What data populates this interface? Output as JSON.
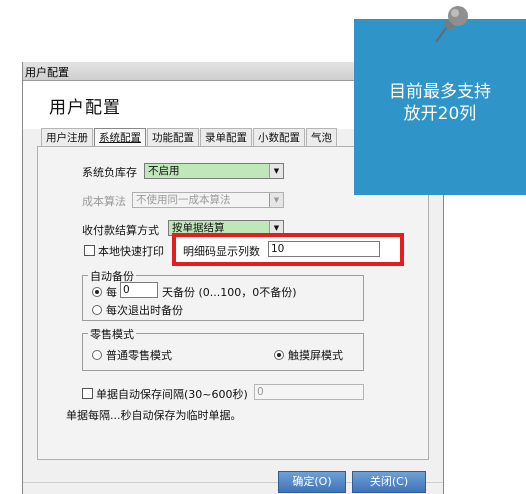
{
  "window": {
    "titlebar": "用户配置",
    "title": "用户配置",
    "tabs": [
      "用户注册",
      "系统配置",
      "功能配置",
      "录单配置",
      "小数配置",
      "气泡"
    ]
  },
  "form": {
    "inventory_label": "系统负库存",
    "inventory_value": "不启用",
    "cost_label": "成本算法",
    "cost_value": "不使用同一成本算法",
    "payment_label": "收付款结算方式",
    "payment_value": "按单据结算",
    "quick_print_label": "本地快速打印",
    "detail_columns_label": "明细码显示列数",
    "detail_columns_value": "10",
    "auto_backup": {
      "title": "自动备份",
      "every_prefix": "每",
      "every_days_value": "0",
      "every_suffix": "天备份 (0...100，0不备份)",
      "on_exit": "每次退出时备份"
    },
    "retail_mode": {
      "title": "零售模式",
      "normal": "普通零售模式",
      "touch": "触摸屏模式"
    },
    "autosave_label": "单据自动保存间隔(30~600秒)",
    "autosave_value": "0",
    "autosave_note": "单据每隔...秒自动保存为临时单据。"
  },
  "buttons": {
    "ok": "确定(O)",
    "close": "关闭(C)"
  },
  "callout": {
    "line1": "目前最多支持",
    "line2": "放开20列"
  },
  "colors": {
    "callout_bg": "#2f94c8",
    "highlight_border": "#e41d1d",
    "combo_green": "#bfe8b8",
    "button_blue": "#3e74b8"
  }
}
